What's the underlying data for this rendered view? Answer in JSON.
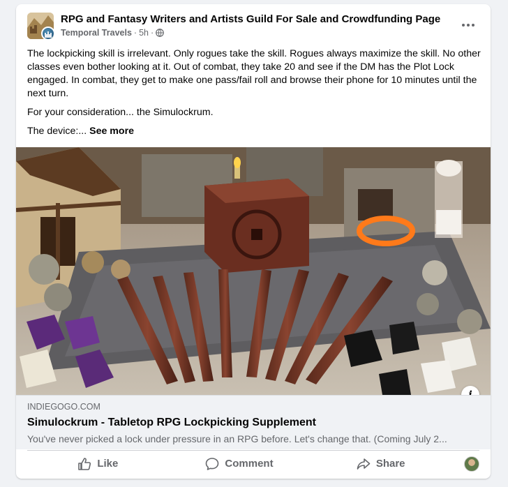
{
  "post": {
    "page_name": "RPG and Fantasy Writers and Artists Guild For Sale and Crowdfunding Page",
    "author": "Temporal Travels",
    "time": "5h",
    "separator": "·",
    "privacy_icon": "globe-icon",
    "paragraphs": [
      "The lockpicking skill is irrelevant. Only rogues take the skill. Rogues always maximize the skill. No other classes even bother looking at it. Out of combat, they take 20 and see if the DM has the Plot Lock engaged. In combat, they get to make one pass/fail roll and browse their phone for 10 minutes until the next turn.",
      "For your consideration... the Simulockrum."
    ],
    "truncated_line": "The device:...",
    "see_more_label": "See more"
  },
  "link": {
    "domain": "INDIEGOGO.COM",
    "title": "Simulockrum - Tabletop RPG Lockpicking Supplement",
    "description": "You've never picked a lock under pressure in an RPG before. Let's change that. (Coming July 2..."
  },
  "actions": {
    "like_label": "Like",
    "comment_label": "Comment",
    "share_label": "Share"
  },
  "info_symbol": "i",
  "colors": {
    "text": "#050505",
    "secondary": "#65676b",
    "background": "#f0f2f5"
  }
}
